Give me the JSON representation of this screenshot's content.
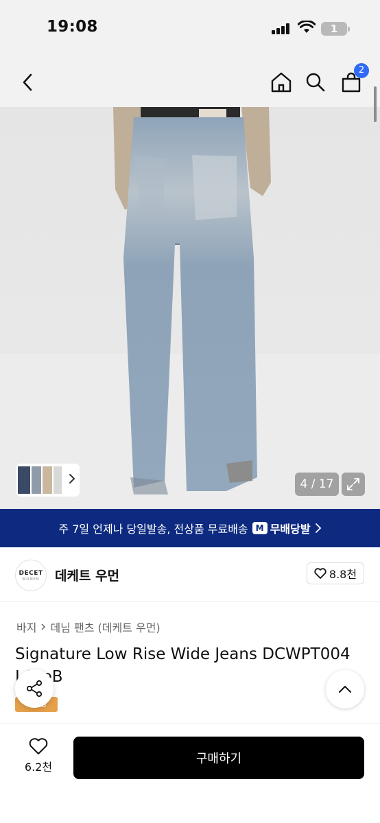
{
  "status_bar": {
    "time": "19:08",
    "battery": "1"
  },
  "nav": {
    "cart_count": "2"
  },
  "gallery": {
    "counter": "4 / 17"
  },
  "promo": {
    "text": "주 7일 언제나 당일발송, 전상품 무료배송",
    "badge_label": "무배당발",
    "badge_icon": "M"
  },
  "brand": {
    "logo_text": "DECET",
    "logo_subtext": "WOMEN",
    "name": "데케트 우먼",
    "likes": "8.8천"
  },
  "product": {
    "breadcrumb": [
      "바지",
      "데님 팬츠 (데케트 우먼)"
    ],
    "title": "Signature Low Rise Wide Jeans DCWPT004 LGreB",
    "tag": "S급상"
  },
  "bottom_bar": {
    "wish_count": "6.2천",
    "buy_label": "구매하기"
  },
  "colors": {
    "promo_bg": "#0d2a80",
    "badge_blue": "#2f6bf4",
    "tag_orange": "#e6a04a",
    "buy_bg": "#000000"
  }
}
